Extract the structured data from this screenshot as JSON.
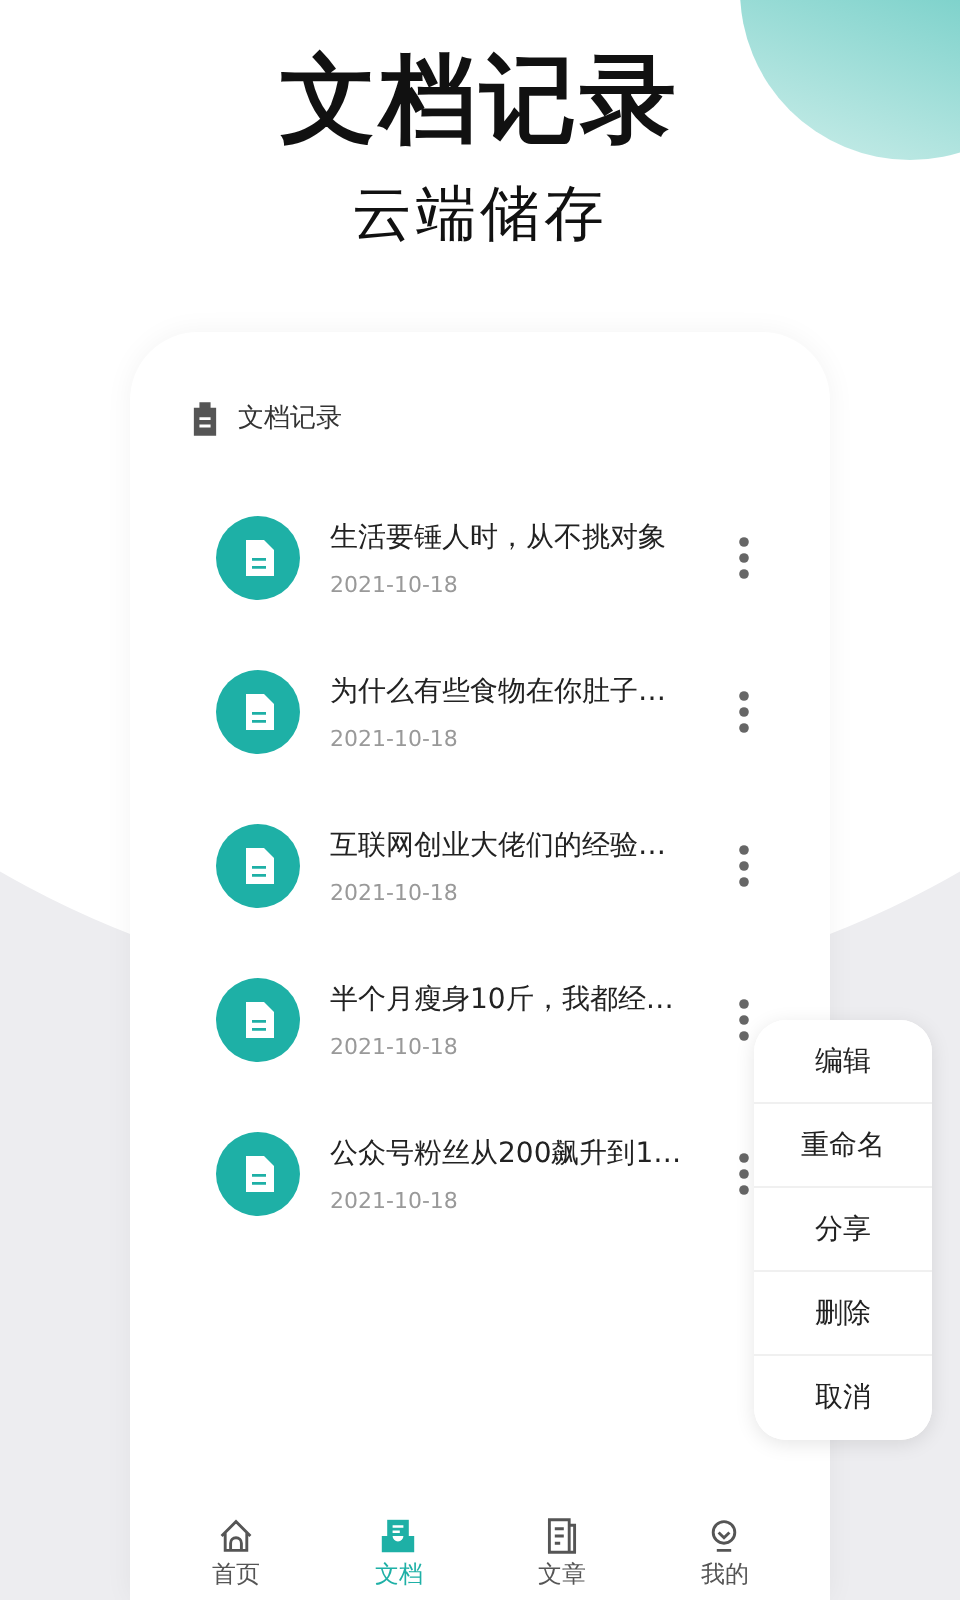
{
  "header": {
    "title": "文档记录",
    "subtitle": "云端储存"
  },
  "card": {
    "title": "文档记录"
  },
  "documents": [
    {
      "title": "生活要锤人时，从不挑对象",
      "date": "2021-10-18"
    },
    {
      "title": "为什么有些食物在你肚子…",
      "date": "2021-10-18"
    },
    {
      "title": "互联网创业大佬们的经验…",
      "date": "2021-10-18"
    },
    {
      "title": "半个月瘦身10斤，我都经…",
      "date": "2021-10-18"
    },
    {
      "title": "公众号粉丝从200飙升到1…",
      "date": "2021-10-18"
    }
  ],
  "menu": [
    "编辑",
    "重命名",
    "分享",
    "删除",
    "取消"
  ],
  "nav": [
    {
      "label": "首页",
      "kind": "home",
      "selected": false
    },
    {
      "label": "文档",
      "kind": "docs",
      "selected": true
    },
    {
      "label": "文章",
      "kind": "article",
      "selected": false
    },
    {
      "label": "我的",
      "kind": "profile",
      "selected": false
    }
  ]
}
